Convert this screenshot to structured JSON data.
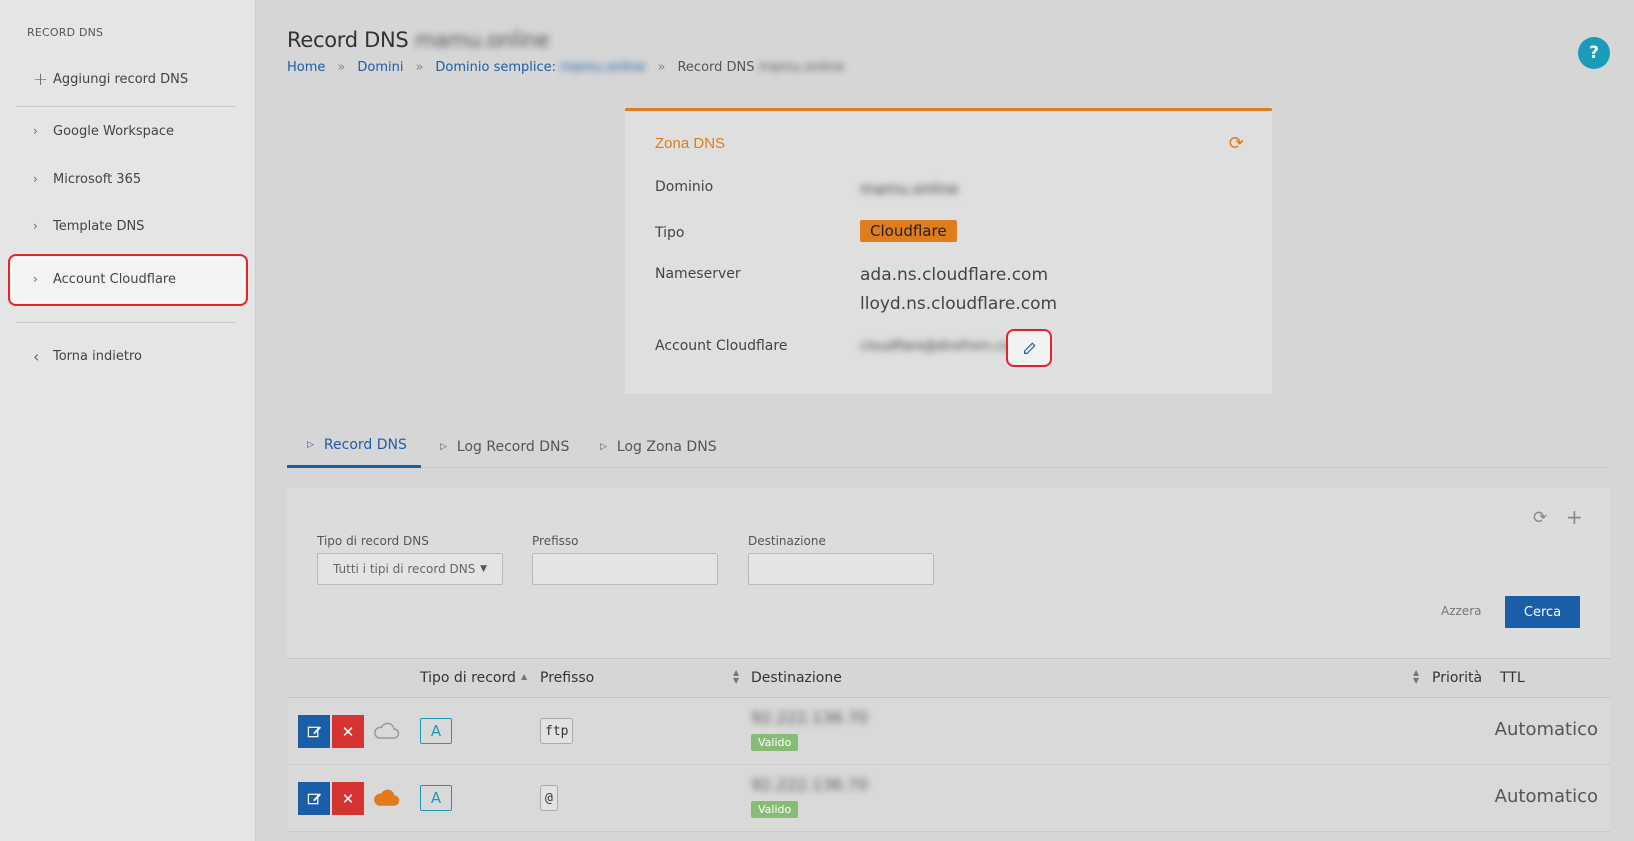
{
  "sidebar": {
    "heading": "RECORD DNS",
    "add_label": "Aggiungi record DNS",
    "items": [
      "Google Workspace",
      "Microsoft 365",
      "Template DNS",
      "Account Cloudflare"
    ],
    "back_label": "Torna indietro"
  },
  "header": {
    "title": "Record DNS",
    "title_domain": "mamu.online",
    "breadcrumb": {
      "home": "Home",
      "domains": "Domini",
      "simple_domain": "Dominio semplice:",
      "simple_domain_value": "mamu.online",
      "current": "Record DNS",
      "current_value": "mamu.online"
    },
    "help_label": "?"
  },
  "zone": {
    "title": "Zona DNS",
    "domain_label": "Dominio",
    "domain_value": "mamu.online",
    "type_label": "Tipo",
    "type_value": "Cloudflare",
    "nameserver_label": "Nameserver",
    "nameservers": [
      "ada.ns.cloudflare.com",
      "lloyd.ns.cloudflare.com"
    ],
    "account_label": "Account Cloudflare",
    "account_value": "cloudflare@dnsfrom.com"
  },
  "tabs": [
    "Record DNS",
    "Log Record DNS",
    "Log Zona DNS"
  ],
  "filters": {
    "record_type_label": "Tipo di record DNS",
    "record_type_value": "Tutti i tipi di record DNS",
    "prefix_label": "Prefisso",
    "prefix_value": "",
    "destination_label": "Destinazione",
    "destination_value": "",
    "reset_label": "Azzera",
    "search_label": "Cerca"
  },
  "table": {
    "columns": [
      "Tipo di record",
      "Prefisso",
      "Destinazione",
      "Priorità",
      "TTL"
    ],
    "rows": [
      {
        "type": "A",
        "prefix": "ftp",
        "destination": "92.222.136.70",
        "status": "Valido",
        "ttl": "Automatico",
        "proxied": false
      },
      {
        "type": "A",
        "prefix": "@",
        "destination": "92.222.136.70",
        "status": "Valido",
        "ttl": "Automatico",
        "proxied": true
      }
    ]
  },
  "colors": {
    "accent": "#1b5ea8",
    "cloudflare": "#e07b1e",
    "danger": "#d63333",
    "valid": "#84bd73",
    "info": "#1a9bb9"
  }
}
